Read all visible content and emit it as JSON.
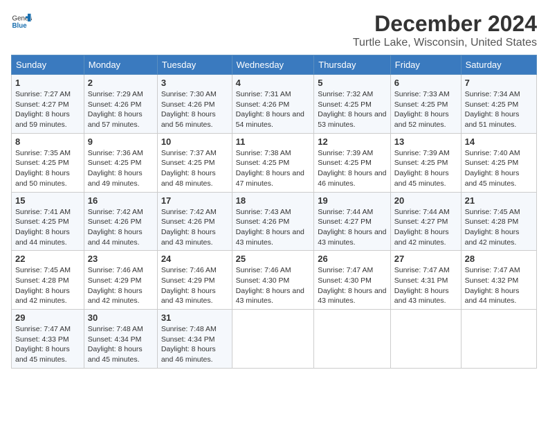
{
  "logo": {
    "general": "General",
    "blue": "Blue"
  },
  "title": "December 2024",
  "subtitle": "Turtle Lake, Wisconsin, United States",
  "days_of_week": [
    "Sunday",
    "Monday",
    "Tuesday",
    "Wednesday",
    "Thursday",
    "Friday",
    "Saturday"
  ],
  "weeks": [
    [
      {
        "day": 1,
        "sunrise": "7:27 AM",
        "sunset": "4:27 PM",
        "daylight": "8 hours and 59 minutes."
      },
      {
        "day": 2,
        "sunrise": "7:29 AM",
        "sunset": "4:26 PM",
        "daylight": "8 hours and 57 minutes."
      },
      {
        "day": 3,
        "sunrise": "7:30 AM",
        "sunset": "4:26 PM",
        "daylight": "8 hours and 56 minutes."
      },
      {
        "day": 4,
        "sunrise": "7:31 AM",
        "sunset": "4:26 PM",
        "daylight": "8 hours and 54 minutes."
      },
      {
        "day": 5,
        "sunrise": "7:32 AM",
        "sunset": "4:25 PM",
        "daylight": "8 hours and 53 minutes."
      },
      {
        "day": 6,
        "sunrise": "7:33 AM",
        "sunset": "4:25 PM",
        "daylight": "8 hours and 52 minutes."
      },
      {
        "day": 7,
        "sunrise": "7:34 AM",
        "sunset": "4:25 PM",
        "daylight": "8 hours and 51 minutes."
      }
    ],
    [
      {
        "day": 8,
        "sunrise": "7:35 AM",
        "sunset": "4:25 PM",
        "daylight": "8 hours and 50 minutes."
      },
      {
        "day": 9,
        "sunrise": "7:36 AM",
        "sunset": "4:25 PM",
        "daylight": "8 hours and 49 minutes."
      },
      {
        "day": 10,
        "sunrise": "7:37 AM",
        "sunset": "4:25 PM",
        "daylight": "8 hours and 48 minutes."
      },
      {
        "day": 11,
        "sunrise": "7:38 AM",
        "sunset": "4:25 PM",
        "daylight": "8 hours and 47 minutes."
      },
      {
        "day": 12,
        "sunrise": "7:39 AM",
        "sunset": "4:25 PM",
        "daylight": "8 hours and 46 minutes."
      },
      {
        "day": 13,
        "sunrise": "7:39 AM",
        "sunset": "4:25 PM",
        "daylight": "8 hours and 45 minutes."
      },
      {
        "day": 14,
        "sunrise": "7:40 AM",
        "sunset": "4:25 PM",
        "daylight": "8 hours and 45 minutes."
      }
    ],
    [
      {
        "day": 15,
        "sunrise": "7:41 AM",
        "sunset": "4:25 PM",
        "daylight": "8 hours and 44 minutes."
      },
      {
        "day": 16,
        "sunrise": "7:42 AM",
        "sunset": "4:26 PM",
        "daylight": "8 hours and 44 minutes."
      },
      {
        "day": 17,
        "sunrise": "7:42 AM",
        "sunset": "4:26 PM",
        "daylight": "8 hours and 43 minutes."
      },
      {
        "day": 18,
        "sunrise": "7:43 AM",
        "sunset": "4:26 PM",
        "daylight": "8 hours and 43 minutes."
      },
      {
        "day": 19,
        "sunrise": "7:44 AM",
        "sunset": "4:27 PM",
        "daylight": "8 hours and 43 minutes."
      },
      {
        "day": 20,
        "sunrise": "7:44 AM",
        "sunset": "4:27 PM",
        "daylight": "8 hours and 42 minutes."
      },
      {
        "day": 21,
        "sunrise": "7:45 AM",
        "sunset": "4:28 PM",
        "daylight": "8 hours and 42 minutes."
      }
    ],
    [
      {
        "day": 22,
        "sunrise": "7:45 AM",
        "sunset": "4:28 PM",
        "daylight": "8 hours and 42 minutes."
      },
      {
        "day": 23,
        "sunrise": "7:46 AM",
        "sunset": "4:29 PM",
        "daylight": "8 hours and 42 minutes."
      },
      {
        "day": 24,
        "sunrise": "7:46 AM",
        "sunset": "4:29 PM",
        "daylight": "8 hours and 43 minutes."
      },
      {
        "day": 25,
        "sunrise": "7:46 AM",
        "sunset": "4:30 PM",
        "daylight": "8 hours and 43 minutes."
      },
      {
        "day": 26,
        "sunrise": "7:47 AM",
        "sunset": "4:30 PM",
        "daylight": "8 hours and 43 minutes."
      },
      {
        "day": 27,
        "sunrise": "7:47 AM",
        "sunset": "4:31 PM",
        "daylight": "8 hours and 43 minutes."
      },
      {
        "day": 28,
        "sunrise": "7:47 AM",
        "sunset": "4:32 PM",
        "daylight": "8 hours and 44 minutes."
      }
    ],
    [
      {
        "day": 29,
        "sunrise": "7:47 AM",
        "sunset": "4:33 PM",
        "daylight": "8 hours and 45 minutes."
      },
      {
        "day": 30,
        "sunrise": "7:48 AM",
        "sunset": "4:34 PM",
        "daylight": "8 hours and 45 minutes."
      },
      {
        "day": 31,
        "sunrise": "7:48 AM",
        "sunset": "4:34 PM",
        "daylight": "8 hours and 46 minutes."
      },
      null,
      null,
      null,
      null
    ]
  ],
  "labels": {
    "sunrise": "Sunrise:",
    "sunset": "Sunset:",
    "daylight": "Daylight:"
  }
}
